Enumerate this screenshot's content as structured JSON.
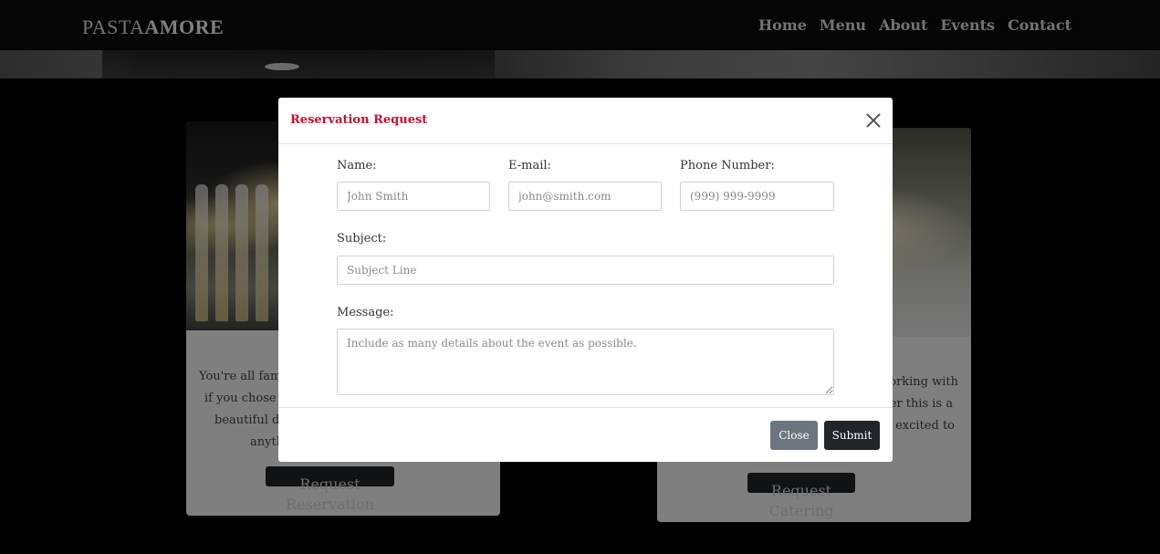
{
  "brand": {
    "part1": "PASTA",
    "part2": "AMORE"
  },
  "nav": {
    "items": [
      "Home",
      "Menu",
      "About",
      "Events",
      "Contact"
    ]
  },
  "cards": {
    "left": {
      "text_lines": [
        "You're all family",
        "if you chose ou",
        "beautiful din",
        "anyth"
      ],
      "button": "Request Reservation"
    },
    "right": {
      "text_lines": [
        "working with",
        "ther this is a",
        "e excited to"
      ],
      "button": "Request Catering"
    }
  },
  "modal": {
    "title": "Reservation Request",
    "name": {
      "label": "Name:",
      "placeholder": "John Smith"
    },
    "email": {
      "label": "E-mail:",
      "placeholder": "john@smith.com"
    },
    "phone": {
      "label": "Phone Number:",
      "placeholder": "(999) 999-9999"
    },
    "subject": {
      "label": "Subject:",
      "placeholder": "Subject Line"
    },
    "message": {
      "label": "Message:",
      "placeholder": "Include as many details about the event as possible."
    },
    "close_label": "Close",
    "submit_label": "Submit"
  },
  "colors": {
    "accent": "#c8102e",
    "dark_button": "#212529",
    "secondary_button": "#6c757d"
  }
}
